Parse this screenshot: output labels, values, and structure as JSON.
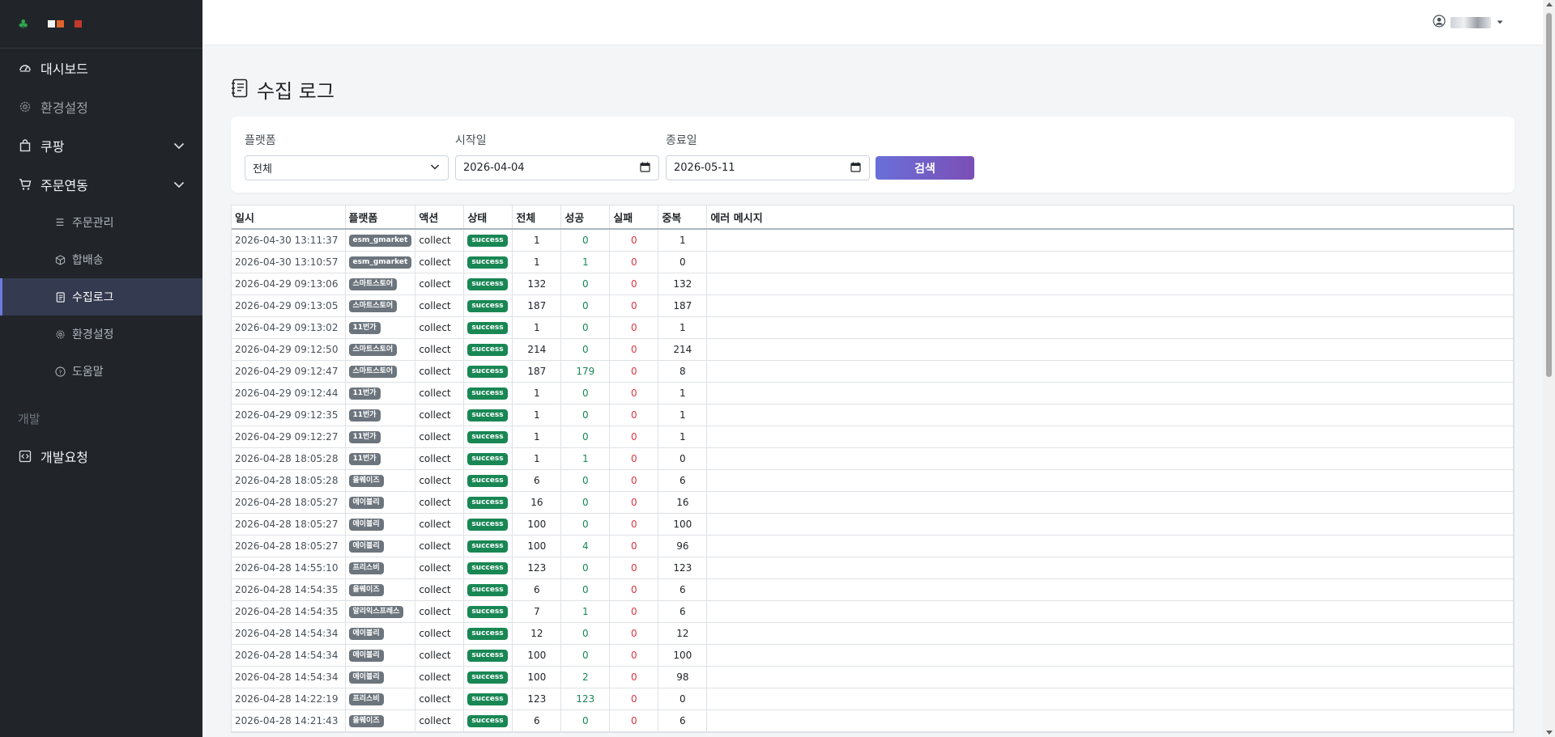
{
  "sidebar": {
    "brand_icon": "clover-icon",
    "items": [
      {
        "label": "대시보드",
        "icon": "speedometer-icon"
      },
      {
        "label": "환경설정",
        "icon": "gear-icon"
      },
      {
        "label": "쿠팡",
        "icon": "bag-icon"
      },
      {
        "label": "주문연동",
        "icon": "cart-icon"
      }
    ],
    "sub_items": [
      {
        "label": "주문관리",
        "icon": "list-icon"
      },
      {
        "label": "합배송",
        "icon": "box-icon"
      },
      {
        "label": "수집로그",
        "icon": "journal-icon"
      },
      {
        "label": "환경설정",
        "icon": "gear-icon"
      },
      {
        "label": "도움말",
        "icon": "question-icon"
      }
    ],
    "section_label": "개발",
    "dev_item": {
      "label": "개발요청",
      "icon": "code-icon"
    }
  },
  "page": {
    "title": "수집 로그"
  },
  "filters": {
    "platform_label": "플랫폼",
    "platform_value": "전체",
    "start_label": "시작일",
    "start_value": "2026-04-04",
    "end_label": "종료일",
    "end_value": "2026-05-11",
    "search_label": "검색"
  },
  "table": {
    "headers": [
      "일시",
      "플랫폼",
      "액션",
      "상태",
      "전체",
      "성공",
      "실패",
      "중복",
      "에러 메시지"
    ],
    "rows": [
      {
        "date": "2026-04-30 13:11:37",
        "platform": "esm_gmarket",
        "action": "collect",
        "status": "success",
        "total": "1",
        "success": "0",
        "fail": "0",
        "dup": "1",
        "error": ""
      },
      {
        "date": "2026-04-30 13:10:57",
        "platform": "esm_gmarket",
        "action": "collect",
        "status": "success",
        "total": "1",
        "success": "1",
        "fail": "0",
        "dup": "0",
        "error": ""
      },
      {
        "date": "2026-04-29 09:13:06",
        "platform": "스마트스토어",
        "action": "collect",
        "status": "success",
        "total": "132",
        "success": "0",
        "fail": "0",
        "dup": "132",
        "error": ""
      },
      {
        "date": "2026-04-29 09:13:05",
        "platform": "스마트스토어",
        "action": "collect",
        "status": "success",
        "total": "187",
        "success": "0",
        "fail": "0",
        "dup": "187",
        "error": ""
      },
      {
        "date": "2026-04-29 09:13:02",
        "platform": "11번가",
        "action": "collect",
        "status": "success",
        "total": "1",
        "success": "0",
        "fail": "0",
        "dup": "1",
        "error": ""
      },
      {
        "date": "2026-04-29 09:12:50",
        "platform": "스마트스토어",
        "action": "collect",
        "status": "success",
        "total": "214",
        "success": "0",
        "fail": "0",
        "dup": "214",
        "error": ""
      },
      {
        "date": "2026-04-29 09:12:47",
        "platform": "스마트스토어",
        "action": "collect",
        "status": "success",
        "total": "187",
        "success": "179",
        "fail": "0",
        "dup": "8",
        "error": ""
      },
      {
        "date": "2026-04-29 09:12:44",
        "platform": "11번가",
        "action": "collect",
        "status": "success",
        "total": "1",
        "success": "0",
        "fail": "0",
        "dup": "1",
        "error": ""
      },
      {
        "date": "2026-04-29 09:12:35",
        "platform": "11번가",
        "action": "collect",
        "status": "success",
        "total": "1",
        "success": "0",
        "fail": "0",
        "dup": "1",
        "error": ""
      },
      {
        "date": "2026-04-29 09:12:27",
        "platform": "11번가",
        "action": "collect",
        "status": "success",
        "total": "1",
        "success": "0",
        "fail": "0",
        "dup": "1",
        "error": ""
      },
      {
        "date": "2026-04-28 18:05:28",
        "platform": "11번가",
        "action": "collect",
        "status": "success",
        "total": "1",
        "success": "1",
        "fail": "0",
        "dup": "0",
        "error": ""
      },
      {
        "date": "2026-04-28 18:05:28",
        "platform": "올웨이즈",
        "action": "collect",
        "status": "success",
        "total": "6",
        "success": "0",
        "fail": "0",
        "dup": "6",
        "error": ""
      },
      {
        "date": "2026-04-28 18:05:27",
        "platform": "에이블리",
        "action": "collect",
        "status": "success",
        "total": "16",
        "success": "0",
        "fail": "0",
        "dup": "16",
        "error": ""
      },
      {
        "date": "2026-04-28 18:05:27",
        "platform": "에이블리",
        "action": "collect",
        "status": "success",
        "total": "100",
        "success": "0",
        "fail": "0",
        "dup": "100",
        "error": ""
      },
      {
        "date": "2026-04-28 18:05:27",
        "platform": "에이블리",
        "action": "collect",
        "status": "success",
        "total": "100",
        "success": "4",
        "fail": "0",
        "dup": "96",
        "error": ""
      },
      {
        "date": "2026-04-28 14:55:10",
        "platform": "프리스비",
        "action": "collect",
        "status": "success",
        "total": "123",
        "success": "0",
        "fail": "0",
        "dup": "123",
        "error": ""
      },
      {
        "date": "2026-04-28 14:54:35",
        "platform": "올웨이즈",
        "action": "collect",
        "status": "success",
        "total": "6",
        "success": "0",
        "fail": "0",
        "dup": "6",
        "error": ""
      },
      {
        "date": "2026-04-28 14:54:35",
        "platform": "알리익스프레스",
        "action": "collect",
        "status": "success",
        "total": "7",
        "success": "1",
        "fail": "0",
        "dup": "6",
        "error": ""
      },
      {
        "date": "2026-04-28 14:54:34",
        "platform": "에이블리",
        "action": "collect",
        "status": "success",
        "total": "12",
        "success": "0",
        "fail": "0",
        "dup": "12",
        "error": ""
      },
      {
        "date": "2026-04-28 14:54:34",
        "platform": "에이블리",
        "action": "collect",
        "status": "success",
        "total": "100",
        "success": "0",
        "fail": "0",
        "dup": "100",
        "error": ""
      },
      {
        "date": "2026-04-28 14:54:34",
        "platform": "에이블리",
        "action": "collect",
        "status": "success",
        "total": "100",
        "success": "2",
        "fail": "0",
        "dup": "98",
        "error": ""
      },
      {
        "date": "2026-04-28 14:22:19",
        "platform": "프리스비",
        "action": "collect",
        "status": "success",
        "total": "123",
        "success": "123",
        "fail": "0",
        "dup": "0",
        "error": ""
      },
      {
        "date": "2026-04-28 14:21:43",
        "platform": "올웨이즈",
        "action": "collect",
        "status": "success",
        "total": "6",
        "success": "0",
        "fail": "0",
        "dup": "6",
        "error": ""
      }
    ]
  },
  "colors": {
    "sidebar_bg": "#212529",
    "accent": "#6c7ae0",
    "success": "#198754",
    "fail": "#dc3545",
    "badge_gray": "#6c757d"
  }
}
